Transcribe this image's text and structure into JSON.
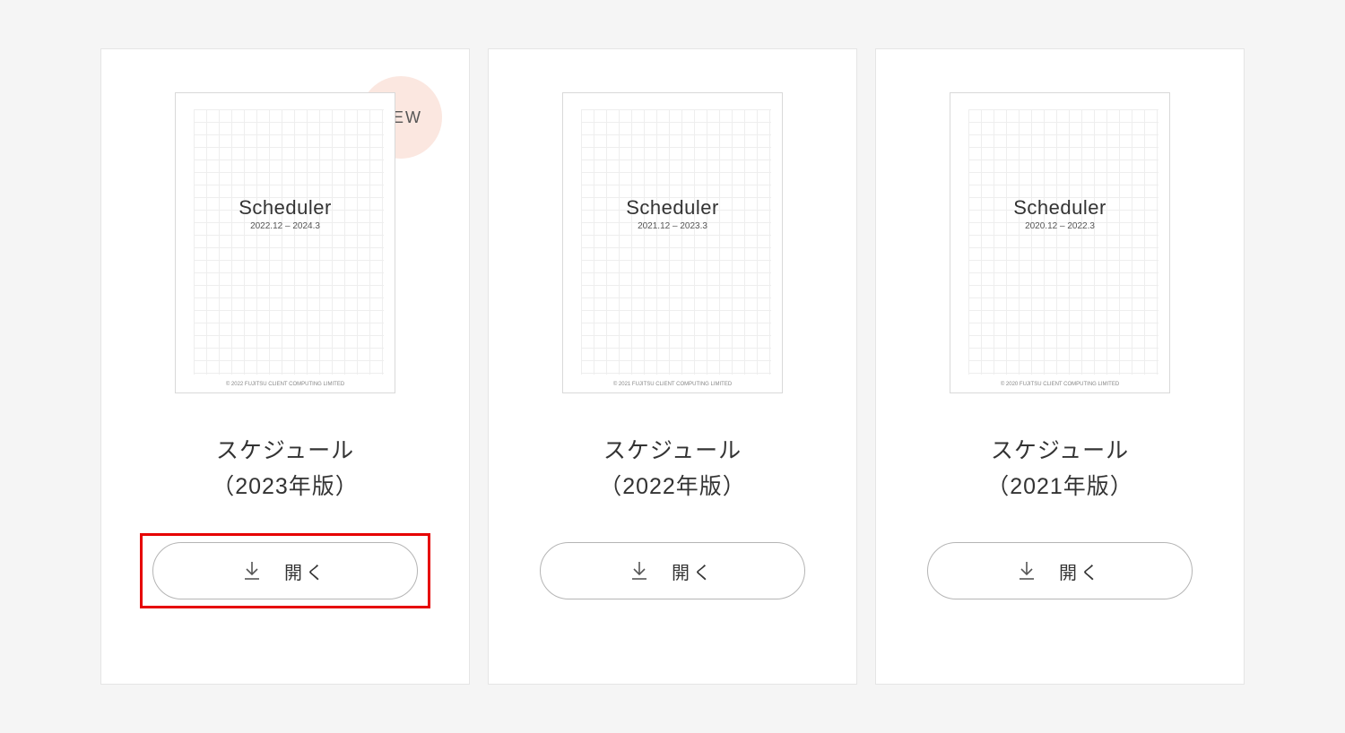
{
  "badge_new": "NEW",
  "open_label": "開く",
  "cards": [
    {
      "thumb_title": "Scheduler",
      "thumb_range": "2022.12 – 2024.3",
      "thumb_footer": "© 2022 FUJITSU CLIENT COMPUTING LIMITED",
      "title_line1": "スケジュール",
      "title_line2": "（2023年版）",
      "is_new": true,
      "highlighted": true
    },
    {
      "thumb_title": "Scheduler",
      "thumb_range": "2021.12 – 2023.3",
      "thumb_footer": "© 2021 FUJITSU CLIENT COMPUTING LIMITED",
      "title_line1": "スケジュール",
      "title_line2": "（2022年版）",
      "is_new": false,
      "highlighted": false
    },
    {
      "thumb_title": "Scheduler",
      "thumb_range": "2020.12 – 2022.3",
      "thumb_footer": "© 2020 FUJITSU CLIENT COMPUTING LIMITED",
      "title_line1": "スケジュール",
      "title_line2": "（2021年版）",
      "is_new": false,
      "highlighted": false
    }
  ]
}
